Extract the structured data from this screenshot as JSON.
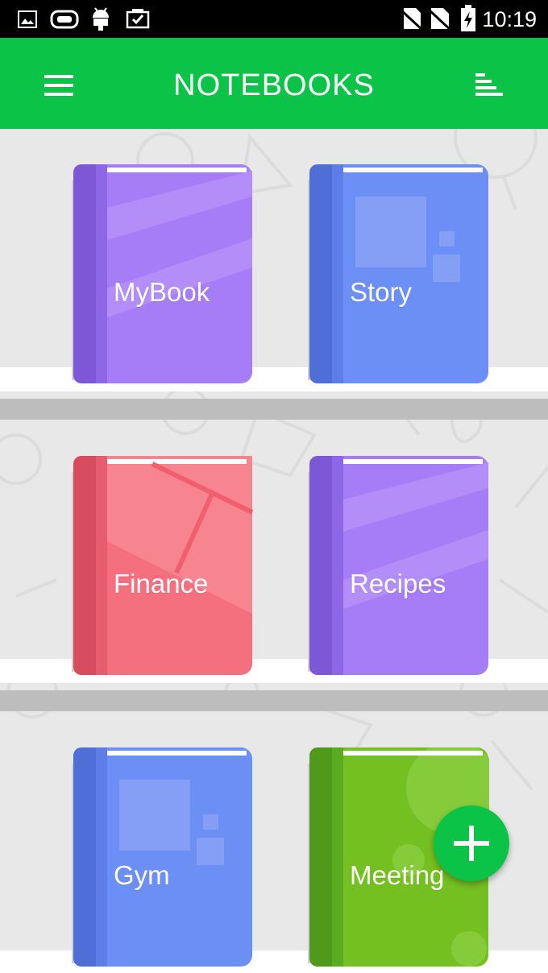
{
  "status_bar": {
    "time": "10:19",
    "left_icons": [
      "image-icon",
      "infinity-icon",
      "android-icon",
      "clipboard-check-icon"
    ],
    "right_icons": [
      "no-sim-icon",
      "no-signal-icon",
      "battery-charging-icon"
    ]
  },
  "app_bar": {
    "title": "NOTEBOOKS",
    "menu_icon": "hamburger-menu-icon",
    "sort_icon": "sort-icon",
    "color": "#0bc347"
  },
  "notebooks": [
    {
      "name": "MyBook",
      "color": "#a67cf7",
      "spine": "#7d58d6",
      "style": "stripes"
    },
    {
      "name": "Story",
      "color": "#6b8ff5",
      "spine": "#4f6fd6",
      "style": "squares"
    },
    {
      "name": "Finance",
      "color": "#f5707f",
      "spine": "#d84c60",
      "style": "lines"
    },
    {
      "name": "Recipes",
      "color": "#a67cf7",
      "spine": "#7d58d6",
      "style": "stripes"
    },
    {
      "name": "Gym",
      "color": "#6b8ff5",
      "spine": "#4f6fd6",
      "style": "squares"
    },
    {
      "name": "Meeting",
      "color": "#74c020",
      "spine": "#4f9a1a",
      "style": "circles"
    }
  ],
  "fab": {
    "icon": "plus-icon",
    "color": "#0bc347"
  }
}
